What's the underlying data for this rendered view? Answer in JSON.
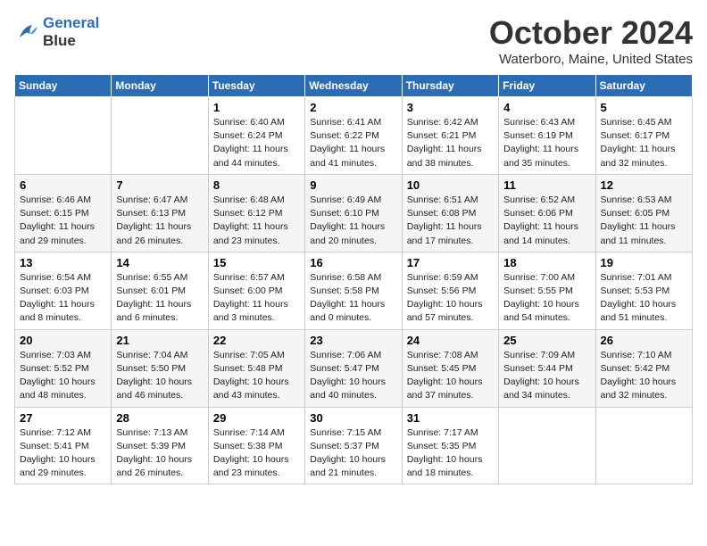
{
  "header": {
    "logo_line1": "General",
    "logo_line2": "Blue",
    "month_title": "October 2024",
    "location": "Waterboro, Maine, United States"
  },
  "weekdays": [
    "Sunday",
    "Monday",
    "Tuesday",
    "Wednesday",
    "Thursday",
    "Friday",
    "Saturday"
  ],
  "weeks": [
    [
      null,
      null,
      {
        "day": 1,
        "sunrise": "6:40 AM",
        "sunset": "6:24 PM",
        "daylight": "11 hours and 44 minutes."
      },
      {
        "day": 2,
        "sunrise": "6:41 AM",
        "sunset": "6:22 PM",
        "daylight": "11 hours and 41 minutes."
      },
      {
        "day": 3,
        "sunrise": "6:42 AM",
        "sunset": "6:21 PM",
        "daylight": "11 hours and 38 minutes."
      },
      {
        "day": 4,
        "sunrise": "6:43 AM",
        "sunset": "6:19 PM",
        "daylight": "11 hours and 35 minutes."
      },
      {
        "day": 5,
        "sunrise": "6:45 AM",
        "sunset": "6:17 PM",
        "daylight": "11 hours and 32 minutes."
      }
    ],
    [
      {
        "day": 6,
        "sunrise": "6:46 AM",
        "sunset": "6:15 PM",
        "daylight": "11 hours and 29 minutes."
      },
      {
        "day": 7,
        "sunrise": "6:47 AM",
        "sunset": "6:13 PM",
        "daylight": "11 hours and 26 minutes."
      },
      {
        "day": 8,
        "sunrise": "6:48 AM",
        "sunset": "6:12 PM",
        "daylight": "11 hours and 23 minutes."
      },
      {
        "day": 9,
        "sunrise": "6:49 AM",
        "sunset": "6:10 PM",
        "daylight": "11 hours and 20 minutes."
      },
      {
        "day": 10,
        "sunrise": "6:51 AM",
        "sunset": "6:08 PM",
        "daylight": "11 hours and 17 minutes."
      },
      {
        "day": 11,
        "sunrise": "6:52 AM",
        "sunset": "6:06 PM",
        "daylight": "11 hours and 14 minutes."
      },
      {
        "day": 12,
        "sunrise": "6:53 AM",
        "sunset": "6:05 PM",
        "daylight": "11 hours and 11 minutes."
      }
    ],
    [
      {
        "day": 13,
        "sunrise": "6:54 AM",
        "sunset": "6:03 PM",
        "daylight": "11 hours and 8 minutes."
      },
      {
        "day": 14,
        "sunrise": "6:55 AM",
        "sunset": "6:01 PM",
        "daylight": "11 hours and 6 minutes."
      },
      {
        "day": 15,
        "sunrise": "6:57 AM",
        "sunset": "6:00 PM",
        "daylight": "11 hours and 3 minutes."
      },
      {
        "day": 16,
        "sunrise": "6:58 AM",
        "sunset": "5:58 PM",
        "daylight": "11 hours and 0 minutes."
      },
      {
        "day": 17,
        "sunrise": "6:59 AM",
        "sunset": "5:56 PM",
        "daylight": "10 hours and 57 minutes."
      },
      {
        "day": 18,
        "sunrise": "7:00 AM",
        "sunset": "5:55 PM",
        "daylight": "10 hours and 54 minutes."
      },
      {
        "day": 19,
        "sunrise": "7:01 AM",
        "sunset": "5:53 PM",
        "daylight": "10 hours and 51 minutes."
      }
    ],
    [
      {
        "day": 20,
        "sunrise": "7:03 AM",
        "sunset": "5:52 PM",
        "daylight": "10 hours and 48 minutes."
      },
      {
        "day": 21,
        "sunrise": "7:04 AM",
        "sunset": "5:50 PM",
        "daylight": "10 hours and 46 minutes."
      },
      {
        "day": 22,
        "sunrise": "7:05 AM",
        "sunset": "5:48 PM",
        "daylight": "10 hours and 43 minutes."
      },
      {
        "day": 23,
        "sunrise": "7:06 AM",
        "sunset": "5:47 PM",
        "daylight": "10 hours and 40 minutes."
      },
      {
        "day": 24,
        "sunrise": "7:08 AM",
        "sunset": "5:45 PM",
        "daylight": "10 hours and 37 minutes."
      },
      {
        "day": 25,
        "sunrise": "7:09 AM",
        "sunset": "5:44 PM",
        "daylight": "10 hours and 34 minutes."
      },
      {
        "day": 26,
        "sunrise": "7:10 AM",
        "sunset": "5:42 PM",
        "daylight": "10 hours and 32 minutes."
      }
    ],
    [
      {
        "day": 27,
        "sunrise": "7:12 AM",
        "sunset": "5:41 PM",
        "daylight": "10 hours and 29 minutes."
      },
      {
        "day": 28,
        "sunrise": "7:13 AM",
        "sunset": "5:39 PM",
        "daylight": "10 hours and 26 minutes."
      },
      {
        "day": 29,
        "sunrise": "7:14 AM",
        "sunset": "5:38 PM",
        "daylight": "10 hours and 23 minutes."
      },
      {
        "day": 30,
        "sunrise": "7:15 AM",
        "sunset": "5:37 PM",
        "daylight": "10 hours and 21 minutes."
      },
      {
        "day": 31,
        "sunrise": "7:17 AM",
        "sunset": "5:35 PM",
        "daylight": "10 hours and 18 minutes."
      },
      null,
      null
    ]
  ]
}
